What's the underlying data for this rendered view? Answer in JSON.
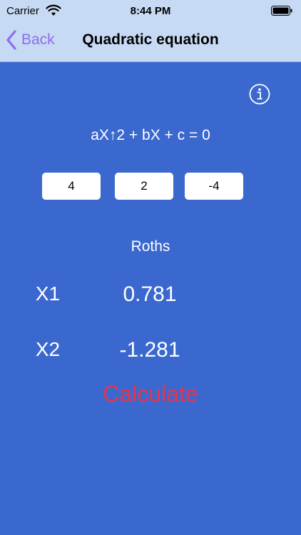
{
  "status_bar": {
    "carrier": "Carrier",
    "time": "8:44 PM"
  },
  "nav": {
    "back_label": "Back",
    "title": "Quadratic equation"
  },
  "info_icon": "info-circle-icon",
  "equation": "aX↑2 + bX + c = 0",
  "coefficients": {
    "a": "4",
    "b": "2",
    "c": "-4"
  },
  "roots": {
    "label": "Roths",
    "x1_label": "X1",
    "x1_value": "0.781",
    "x2_label": "X2",
    "x2_value": "-1.281"
  },
  "calculate_label": "Calculate",
  "colors": {
    "background": "#3a68cf",
    "header": "#c7daf3",
    "accent": "#8e6cf2",
    "calculate": "#e8334a"
  }
}
